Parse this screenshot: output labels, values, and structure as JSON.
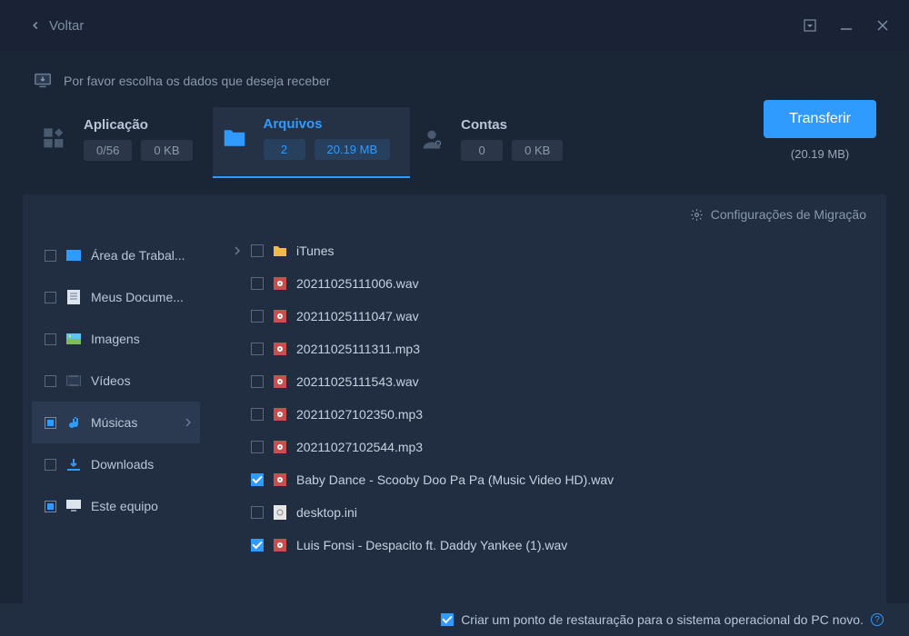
{
  "header": {
    "back_label": "Voltar"
  },
  "instruction": "Por favor escolha os dados que deseja receber",
  "tabs": [
    {
      "title": "Aplicação",
      "stat1": "0/56",
      "stat2": "0 KB"
    },
    {
      "title": "Arquivos",
      "stat1": "2",
      "stat2": "20.19 MB"
    },
    {
      "title": "Contas",
      "stat1": "0",
      "stat2": "0 KB"
    }
  ],
  "transfer": {
    "button": "Transferir",
    "size": "(20.19 MB)"
  },
  "migracao_label": "Configurações de Migração",
  "sidebar": {
    "items": [
      {
        "label": "Área de Trabal...",
        "checked": "none",
        "icon": "desktop"
      },
      {
        "label": "Meus Docume...",
        "checked": "none",
        "icon": "doc"
      },
      {
        "label": "Imagens",
        "checked": "none",
        "icon": "image"
      },
      {
        "label": "Vídeos",
        "checked": "none",
        "icon": "video"
      },
      {
        "label": "Músicas",
        "checked": "partial",
        "icon": "music",
        "selected": true
      },
      {
        "label": "Downloads",
        "checked": "none",
        "icon": "download"
      },
      {
        "label": "Este equipo",
        "checked": "partial",
        "icon": "pc"
      }
    ]
  },
  "files": [
    {
      "name": "iTunes",
      "type": "folder",
      "checked": false
    },
    {
      "name": "20211025111006.wav",
      "type": "audio",
      "checked": false
    },
    {
      "name": "20211025111047.wav",
      "type": "audio",
      "checked": false
    },
    {
      "name": "20211025111311.mp3",
      "type": "audio",
      "checked": false
    },
    {
      "name": "20211025111543.wav",
      "type": "audio",
      "checked": false
    },
    {
      "name": "20211027102350.mp3",
      "type": "audio",
      "checked": false
    },
    {
      "name": "20211027102544.mp3",
      "type": "audio",
      "checked": false
    },
    {
      "name": "Baby Dance - Scooby Doo Pa Pa (Music Video HD).wav",
      "type": "audio",
      "checked": true
    },
    {
      "name": "desktop.ini",
      "type": "ini",
      "checked": false
    },
    {
      "name": "Luis Fonsi - Despacito ft. Daddy Yankee (1).wav",
      "type": "audio",
      "checked": true
    }
  ],
  "footer": {
    "text": "Criar um ponto de restauração para o sistema operacional do PC novo."
  }
}
